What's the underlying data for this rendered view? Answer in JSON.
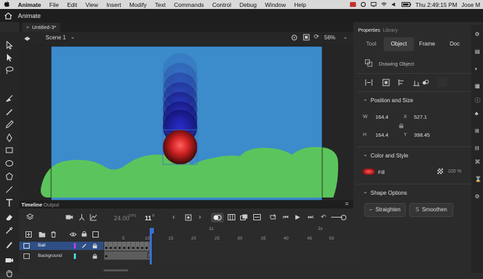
{
  "menubar": {
    "apple_icon": "apple-icon",
    "app_name": "Animate",
    "items": [
      "File",
      "Edit",
      "View",
      "Insert",
      "Modify",
      "Text",
      "Commands",
      "Control",
      "Debug",
      "Window",
      "Help"
    ],
    "clock": "Thu 2:49:15 PM",
    "user": "Jose M"
  },
  "appbar": {
    "app_label": "Animate"
  },
  "document": {
    "tab_title": "Untitled-3*"
  },
  "scene": {
    "label": "Scene 1",
    "zoom": "56%"
  },
  "timeline": {
    "tab_timeline": "Timeline",
    "tab_output": "Output",
    "fps": "24.00",
    "fps_unit": "FPS",
    "current_frame": "11",
    "frame_unit": "F",
    "layers": [
      {
        "name": "Ball",
        "color": "#b140e6",
        "selected": true
      },
      {
        "name": "Background",
        "color": "#43d9d9",
        "selected": false
      }
    ],
    "ruler_seconds": [
      "1s",
      "2s"
    ],
    "ruler_frames": [
      "5",
      "10",
      "15",
      "20",
      "25",
      "30",
      "35",
      "40",
      "45",
      "50"
    ]
  },
  "properties": {
    "panel_tab": "Properties",
    "library_tab": "Library",
    "tabs": [
      "Tool",
      "Object",
      "Frame",
      "Doc"
    ],
    "active_tab": "Object",
    "object_type": "Drawing Object",
    "position_section": "Position and Size",
    "w_label": "W",
    "w_value": "164.4",
    "x_label": "X",
    "x_value": "527.1",
    "h_label": "H",
    "h_value": "164.4",
    "y_label": "Y",
    "y_value": "398.45",
    "color_section": "Color and Style",
    "fill_label": "Fill",
    "fill_alpha": "100 %",
    "shape_section": "Shape Options",
    "straighten_label": "Straighten",
    "smoothen_label": "Smoothen"
  },
  "colors": {
    "stage": "#3c8bcb",
    "grass": "#5cc45c",
    "ball_core": "#e03030",
    "selection": "#3f6ec9"
  }
}
